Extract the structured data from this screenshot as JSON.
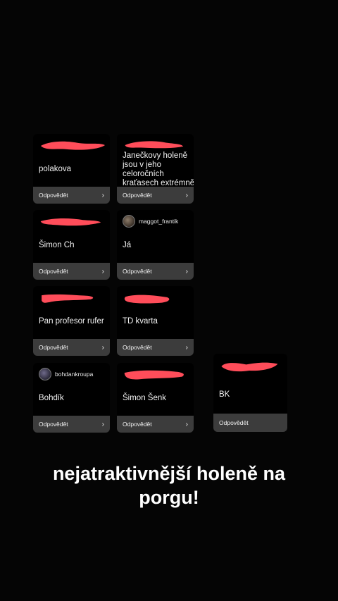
{
  "cards": [
    {
      "id": "c1",
      "text": "polakova",
      "reply": "Odpovědět"
    },
    {
      "id": "c2",
      "text": "Janečkovy holeně jsou v jeho celoročních kraťasech extrémně hot",
      "reply": "Odpovědět"
    },
    {
      "id": "c3",
      "text": "Šimon Ch",
      "reply": "Odpovědět"
    },
    {
      "id": "c4",
      "username": "maggot_frantik",
      "text": "Já",
      "reply": "Odpovědět"
    },
    {
      "id": "c5",
      "text": "Pan profesor rufer",
      "reply": "Odpovědět"
    },
    {
      "id": "c6",
      "text": "TD kvarta",
      "reply": "Odpovědět"
    },
    {
      "id": "c7",
      "username": "bohdankroupa",
      "text": "Bohdík",
      "reply": "Odpovědět"
    },
    {
      "id": "c8",
      "text": "Šimon Šenk",
      "reply": "Odpovědět"
    },
    {
      "id": "c9",
      "text": "BK",
      "reply": "Odpovědět"
    }
  ],
  "caption": "nejatraktivnější holeně na porgu!",
  "colors": {
    "background": "#050505",
    "card": "#000000",
    "reply_bar": "#3c3c3c",
    "redaction": "#ff4d5a"
  }
}
